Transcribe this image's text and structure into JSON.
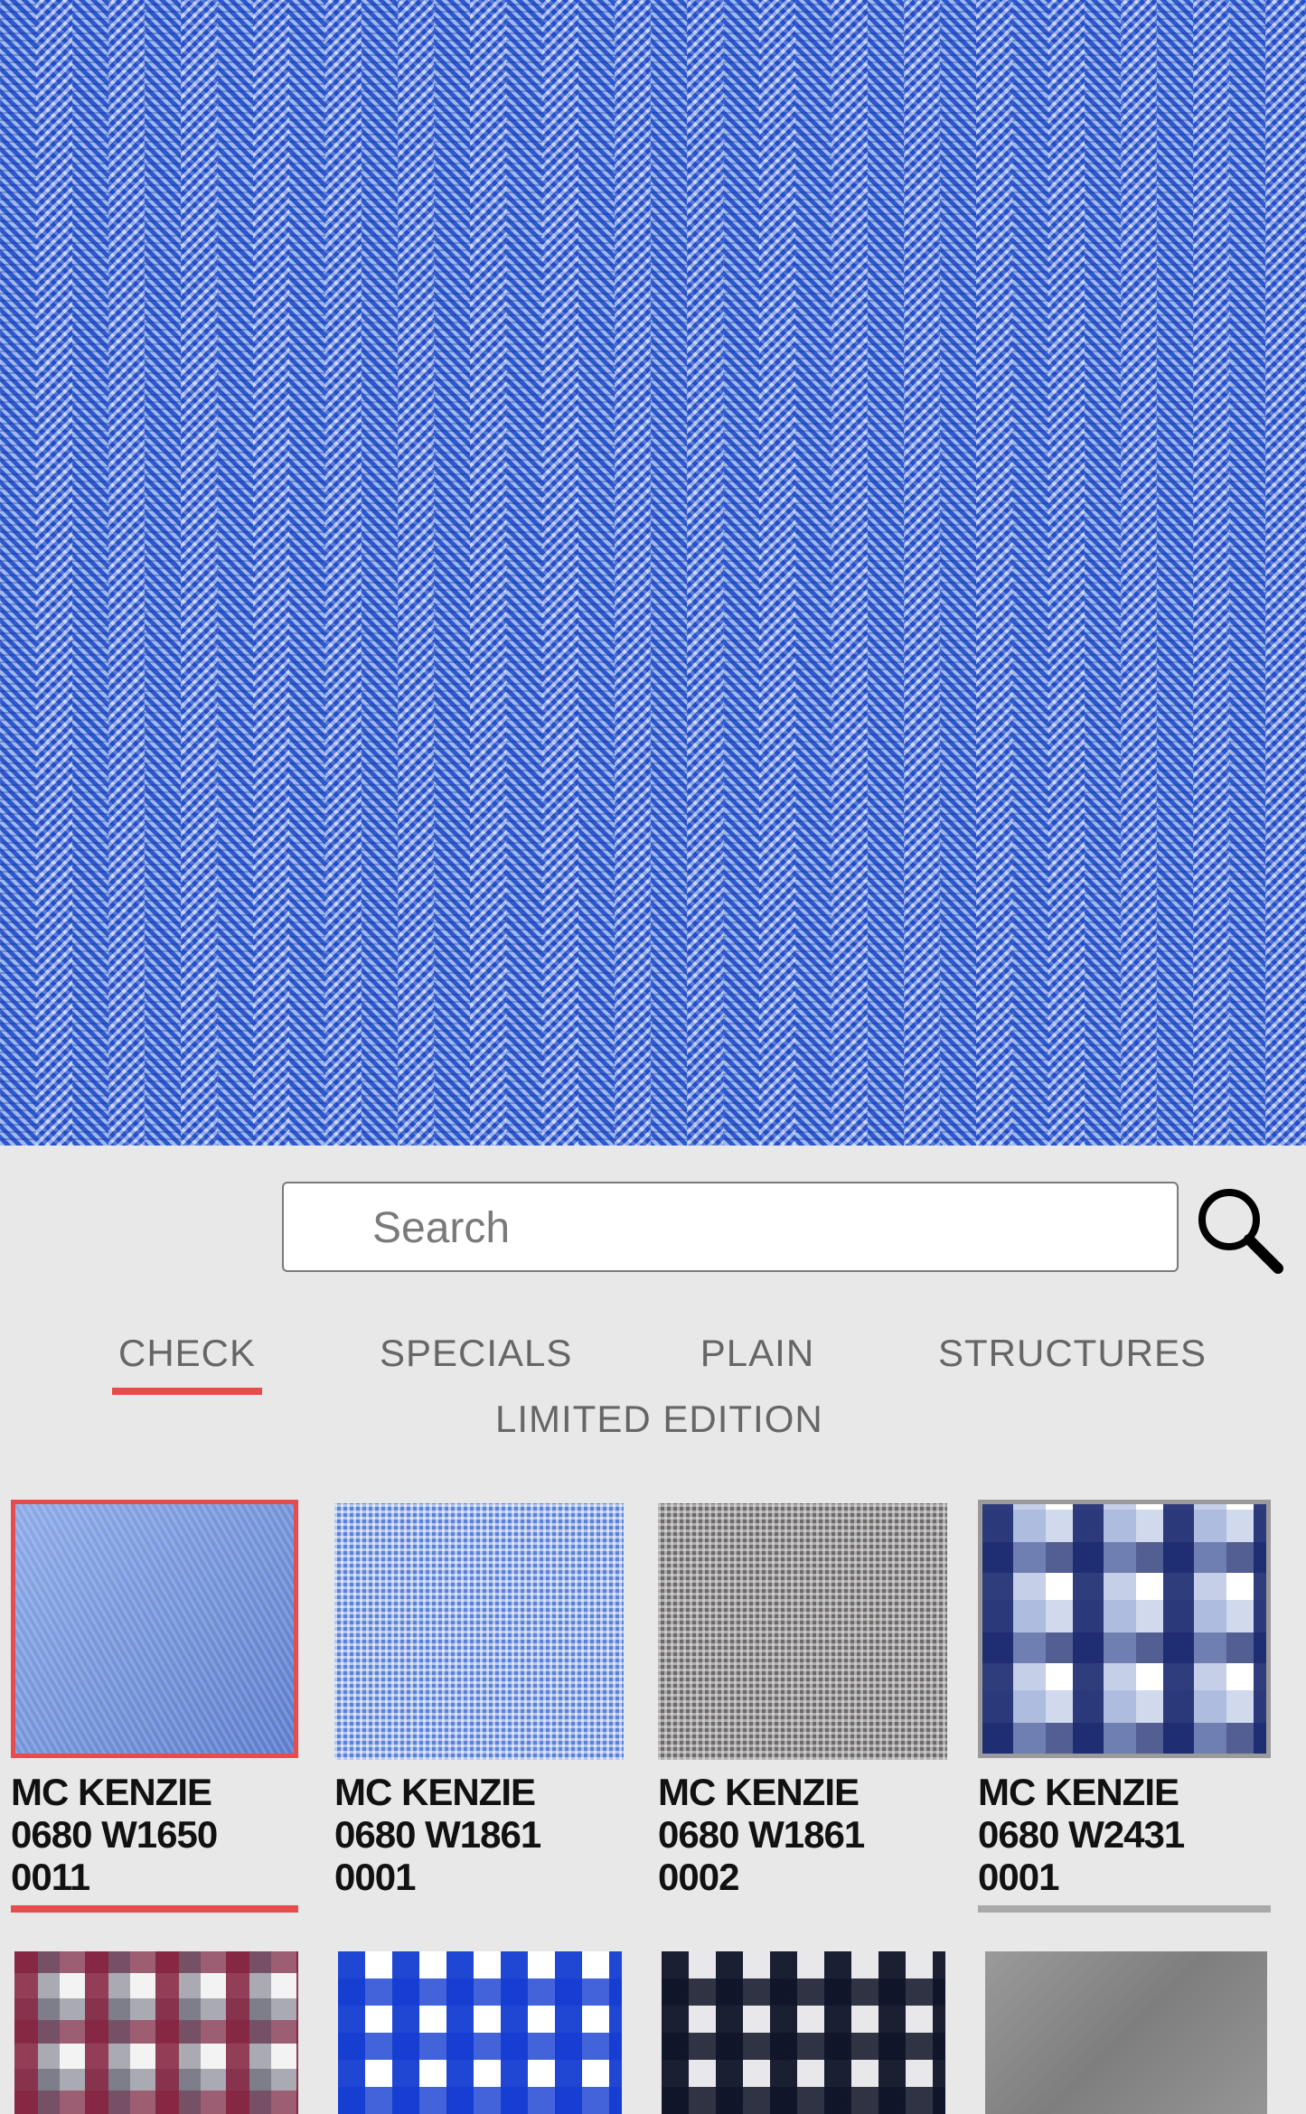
{
  "search": {
    "placeholder": "Search"
  },
  "tabs": [
    {
      "label": "CHECK",
      "active": true
    },
    {
      "label": "SPECIALS",
      "active": false
    },
    {
      "label": "PLAIN",
      "active": false
    },
    {
      "label": "STRUCTURES",
      "active": false
    },
    {
      "label": "LIMITED EDITION",
      "active": false
    }
  ],
  "colors": {
    "accent": "#e84b4b",
    "preview_fabric": "#3f6fd6",
    "panel_bg": "#e8e8e8"
  },
  "swatches": [
    {
      "line1": "MC KENZIE",
      "line2": "0680 W1650",
      "line3": "0011",
      "state": "selected"
    },
    {
      "line1": "MC KENZIE",
      "line2": "0680 W1861",
      "line3": "0001",
      "state": "none"
    },
    {
      "line1": "MC KENZIE",
      "line2": "0680 W1861",
      "line3": "0002",
      "state": "none"
    },
    {
      "line1": "MC KENZIE",
      "line2": "0680 W2431",
      "line3": "0001",
      "state": "highlighted"
    },
    {
      "line1": "",
      "line2": "",
      "line3": "",
      "state": "none"
    },
    {
      "line1": "",
      "line2": "",
      "line3": "",
      "state": "none"
    },
    {
      "line1": "",
      "line2": "",
      "line3": "",
      "state": "none"
    },
    {
      "line1": "",
      "line2": "",
      "line3": "",
      "state": "none"
    }
  ]
}
